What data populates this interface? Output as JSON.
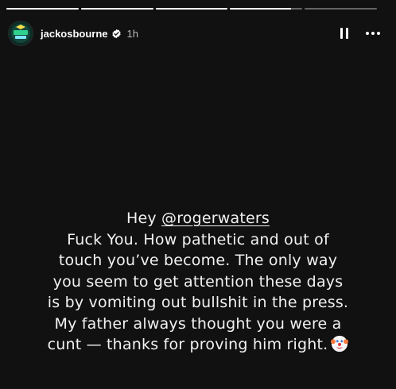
{
  "story": {
    "progress": [
      1,
      1,
      1,
      0.84,
      0
    ],
    "username": "jackosbourne",
    "timestamp": "1h",
    "verified": true,
    "avatar_icon": "jackos-profile-icon",
    "pause_icon": "pause-icon",
    "more_icon": "more-options-icon"
  },
  "caption": {
    "line1_prefix": "Hey ",
    "mention": "@rogerwaters",
    "line2": "Fuck You. How pathetic and out of",
    "line3": "touch you’ve become. The only way",
    "line4": "you seem to get attention these days",
    "line5": "is by vomiting out bullshit in the press.",
    "line6": "My father always thought you were a",
    "line7": "cunt — thanks for proving him right.",
    "emoji_icon": "clown-face-icon"
  },
  "colors": {
    "background": "#111111",
    "text": "#f2f2f2",
    "verified_badge": "#ffffff"
  }
}
